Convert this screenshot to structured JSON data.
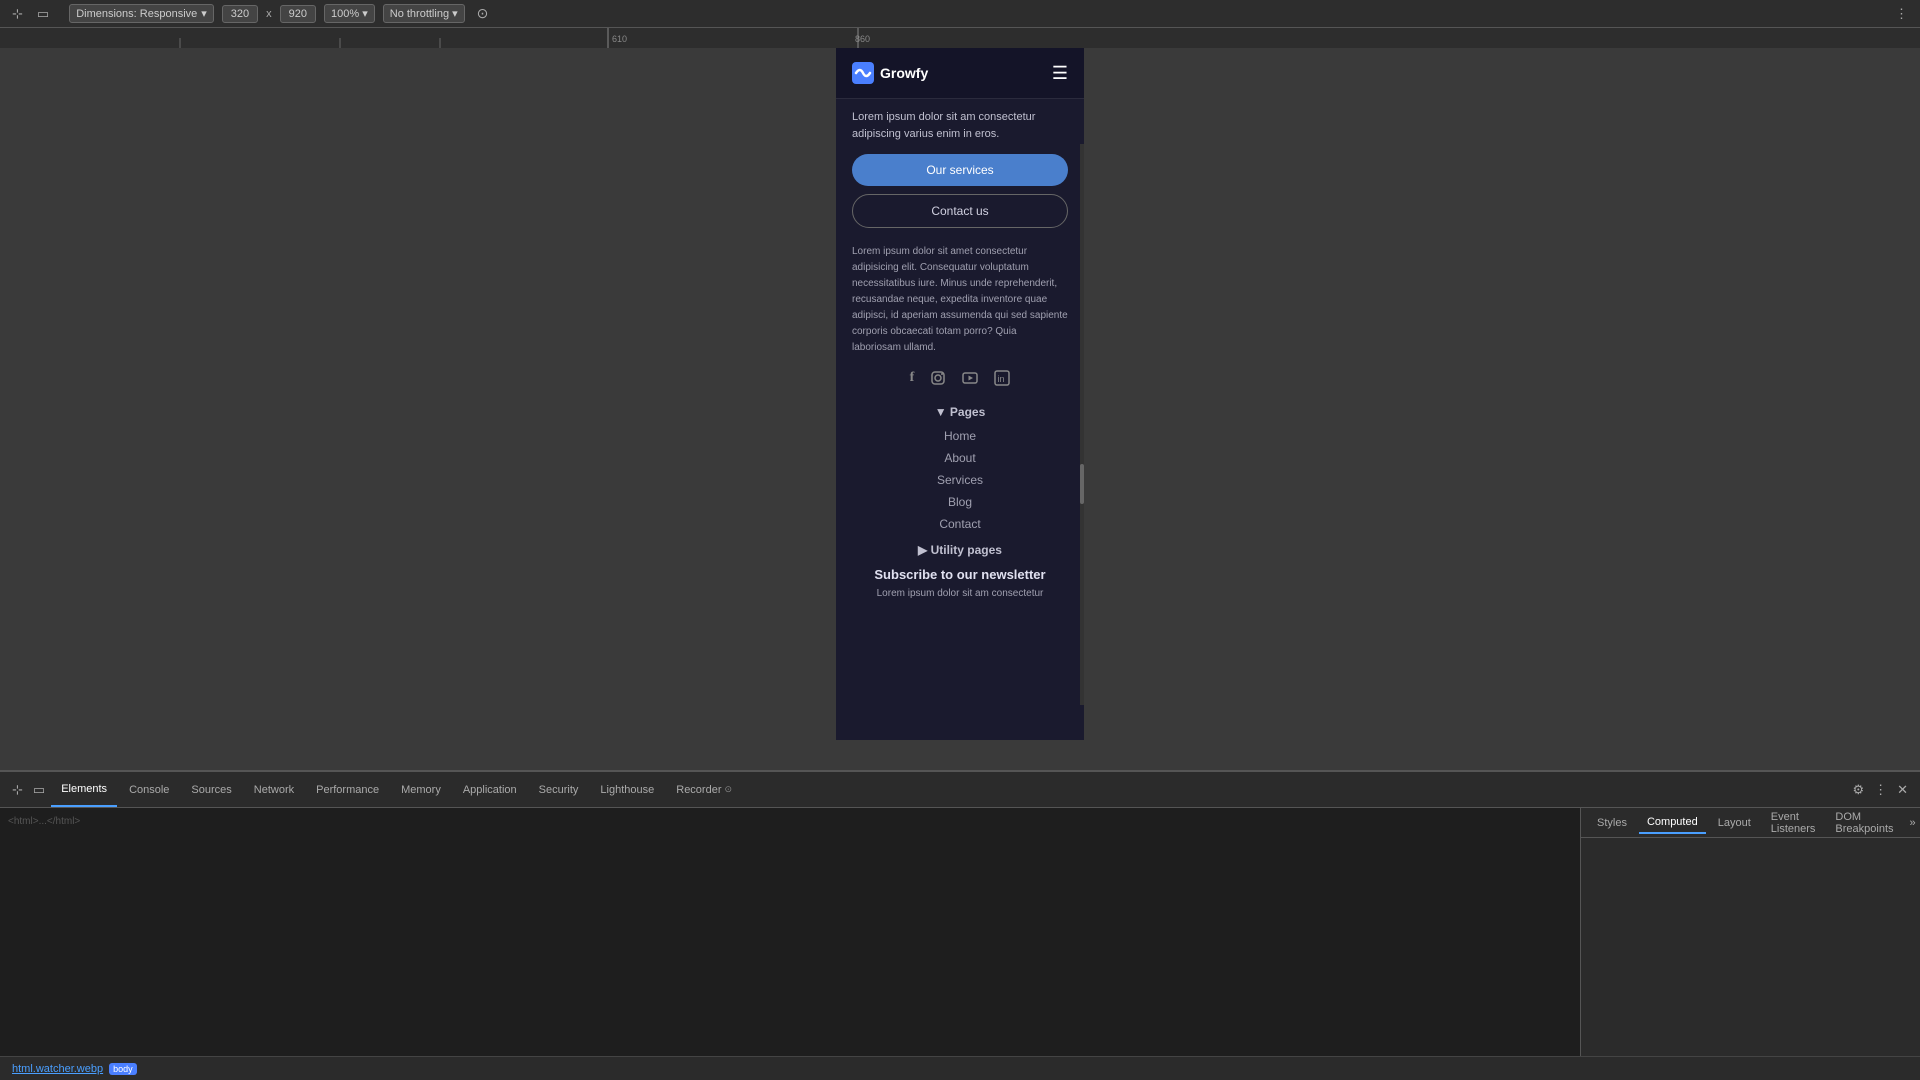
{
  "browser": {
    "responsive_label": "Dimensions: Responsive",
    "width": "320",
    "x_separator": "x",
    "height": "920",
    "zoom": "100%",
    "throttle": "No throttling",
    "settings_icon": "⠿"
  },
  "navbar": {
    "logo_text": "Growfy",
    "hamburger": "☰"
  },
  "hero": {
    "partial_text": "Lorem ipsum dolor sit am consectetur adipiscing varius enim in eros."
  },
  "buttons": {
    "services_label": "Our services",
    "contact_label": "Contact us"
  },
  "body_text": "Lorem ipsum dolor sit amet consectetur adipisicing elit. Consequatur voluptatum necessitatibus iure. Minus unde reprehenderit, recusandae neque, expedita inventore quae adipisci, id aperiam assumenda qui sed sapiente corporis obcaecati totam porro? Quia laboriosam ullamd.",
  "social_icons": {
    "facebook": "f",
    "instagram": "◎",
    "youtube": "▶",
    "linkedin": "in"
  },
  "pages_section": {
    "title": "▼ Pages",
    "links": [
      "Home",
      "About",
      "Services",
      "Blog",
      "Contact"
    ]
  },
  "utility_section": {
    "title": "▶ Utility pages"
  },
  "newsletter": {
    "title": "Subscribe to our newsletter",
    "text": "Lorem ipsum dolor sit am consectetur"
  },
  "devtools": {
    "tabs": [
      {
        "label": "Elements",
        "active": true
      },
      {
        "label": "Console",
        "active": false
      },
      {
        "label": "Sources",
        "active": false
      },
      {
        "label": "Network",
        "active": false
      },
      {
        "label": "Performance",
        "active": false
      },
      {
        "label": "Memory",
        "active": false
      },
      {
        "label": "Application",
        "active": false
      },
      {
        "label": "Security",
        "active": false
      },
      {
        "label": "Lighthouse",
        "active": false
      },
      {
        "label": "Recorder",
        "active": false
      }
    ],
    "panel_tabs": [
      {
        "label": "Styles",
        "active": false
      },
      {
        "label": "Computed",
        "active": true
      },
      {
        "label": "Layout",
        "active": false
      },
      {
        "label": "Event Listeners",
        "active": false
      },
      {
        "label": "DOM Breakpoints",
        "active": false
      }
    ],
    "more_tabs": "»",
    "file_label": "html.watcher.webp",
    "file_badge": "body",
    "icons": {
      "inspect": "⊹",
      "device": "▭",
      "gear": "⚙",
      "close": "✕",
      "more_vert": "⋮"
    }
  }
}
